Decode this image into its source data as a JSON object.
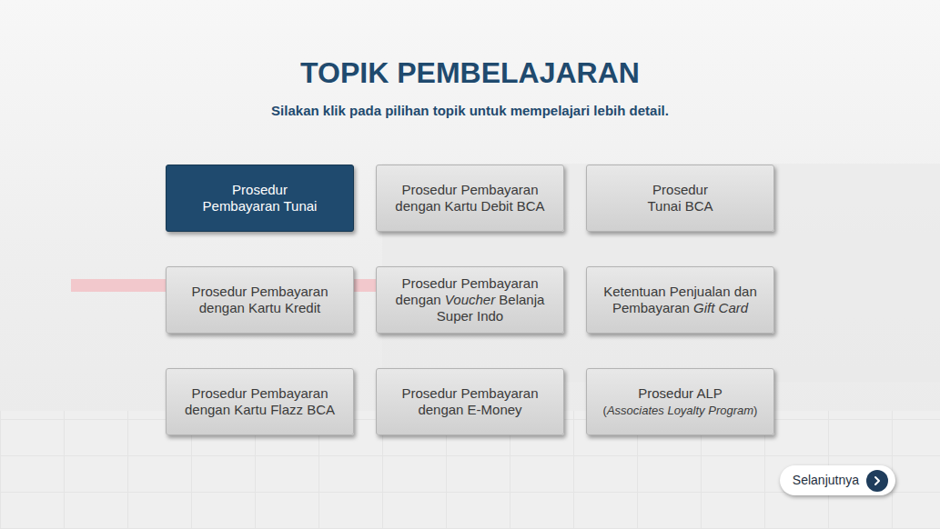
{
  "header": {
    "title": "TOPIK PEMBELAJARAN",
    "subtitle": "Silakan klik pada pilihan topik untuk mempelajari lebih detail."
  },
  "topics": [
    {
      "selected": true,
      "lines": [
        [
          {
            "text": "Prosedur",
            "italic": false,
            "small": false
          }
        ],
        [
          {
            "text": "Pembayaran Tunai",
            "italic": false,
            "small": false
          }
        ]
      ]
    },
    {
      "selected": false,
      "lines": [
        [
          {
            "text": "Prosedur Pembayaran",
            "italic": false,
            "small": false
          }
        ],
        [
          {
            "text": "dengan Kartu Debit BCA",
            "italic": false,
            "small": false
          }
        ]
      ]
    },
    {
      "selected": false,
      "lines": [
        [
          {
            "text": "Prosedur",
            "italic": false,
            "small": false
          }
        ],
        [
          {
            "text": "Tunai BCA",
            "italic": false,
            "small": false
          }
        ]
      ]
    },
    {
      "selected": false,
      "lines": [
        [
          {
            "text": "Prosedur Pembayaran",
            "italic": false,
            "small": false
          }
        ],
        [
          {
            "text": "dengan Kartu Kredit",
            "italic": false,
            "small": false
          }
        ]
      ]
    },
    {
      "selected": false,
      "lines": [
        [
          {
            "text": "Prosedur Pembayaran",
            "italic": false,
            "small": false
          }
        ],
        [
          {
            "text": "dengan ",
            "italic": false,
            "small": false
          },
          {
            "text": "Voucher",
            "italic": true,
            "small": false
          },
          {
            "text": " Belanja",
            "italic": false,
            "small": false
          }
        ],
        [
          {
            "text": "Super Indo",
            "italic": false,
            "small": false
          }
        ]
      ]
    },
    {
      "selected": false,
      "lines": [
        [
          {
            "text": "Ketentuan Penjualan dan",
            "italic": false,
            "small": false
          }
        ],
        [
          {
            "text": "Pembayaran ",
            "italic": false,
            "small": false
          },
          {
            "text": "Gift Card",
            "italic": true,
            "small": false
          }
        ]
      ]
    },
    {
      "selected": false,
      "lines": [
        [
          {
            "text": "Prosedur Pembayaran",
            "italic": false,
            "small": false
          }
        ],
        [
          {
            "text": "dengan Kartu Flazz BCA",
            "italic": false,
            "small": false
          }
        ]
      ]
    },
    {
      "selected": false,
      "lines": [
        [
          {
            "text": "Prosedur Pembayaran",
            "italic": false,
            "small": false
          }
        ],
        [
          {
            "text": "dengan E-Money",
            "italic": false,
            "small": false
          }
        ]
      ]
    },
    {
      "selected": false,
      "lines": [
        [
          {
            "text": "Prosedur ALP",
            "italic": false,
            "small": false
          }
        ],
        [
          {
            "text": "(",
            "italic": false,
            "small": true
          },
          {
            "text": "Associates Loyalty Program",
            "italic": true,
            "small": true
          },
          {
            "text": ")",
            "italic": false,
            "small": true
          }
        ]
      ]
    }
  ],
  "next_button": {
    "label": "Selanjutnya"
  }
}
